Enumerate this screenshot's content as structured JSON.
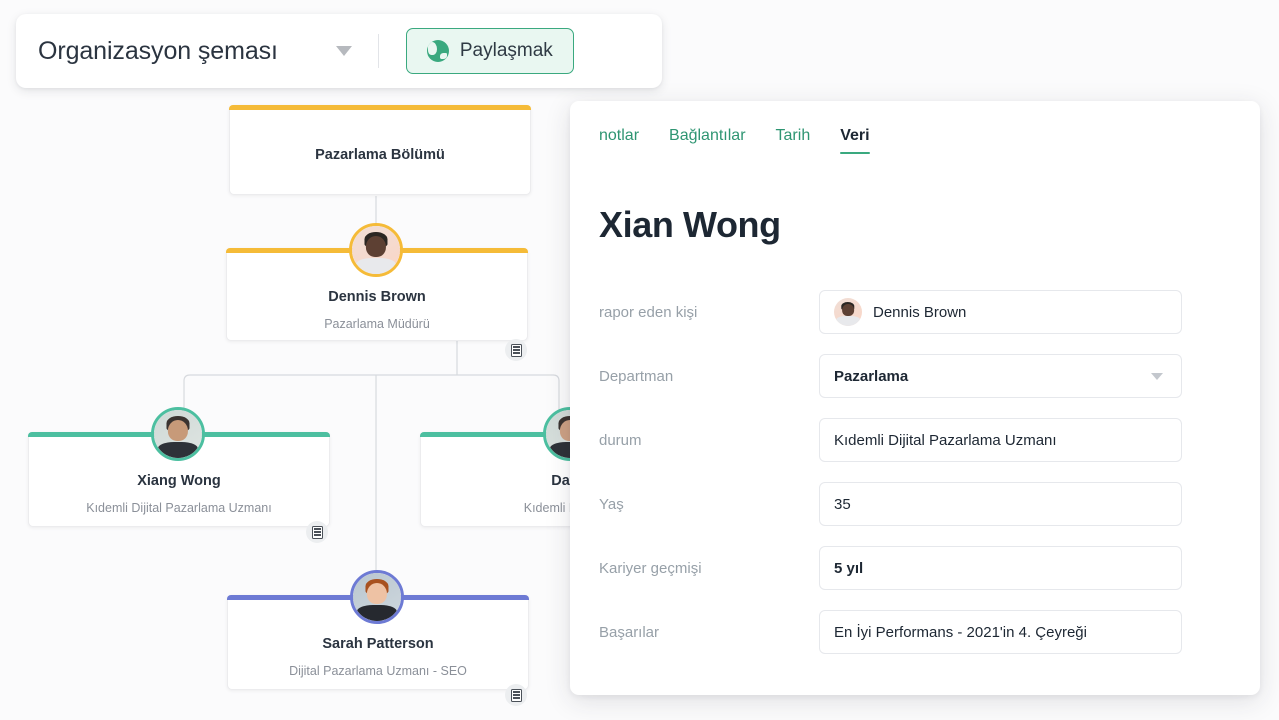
{
  "toolbar": {
    "chart_title": "Organizasyon şeması",
    "dropdown_icon": "chevron-down-icon",
    "share_label": "Paylaşmak",
    "share_icon": "globe-icon"
  },
  "colors": {
    "accent_green": "#3aa97f",
    "tab_link": "#2e9572",
    "node_yellow": "#f5bb38",
    "node_teal": "#4cbfa0",
    "node_purple": "#6d7ad4",
    "page_background": "#fbfbfc"
  },
  "org_chart": {
    "nodes": [
      {
        "id": "department",
        "title": "Pazarlama Bölümü",
        "subtitle": "",
        "accent": "#f5bb38",
        "has_avatar": false,
        "has_db_button": false
      },
      {
        "id": "dennis-brown",
        "title": "Dennis Brown",
        "subtitle": "Pazarlama Müdürü",
        "accent": "#f5bb38",
        "has_avatar": true,
        "has_db_button": true,
        "db_icon": "database-icon"
      },
      {
        "id": "xiang-wong",
        "title": "Xiang Wong",
        "subtitle": "Kıdemli Dijital Pazarlama Uzmanı",
        "accent": "#4cbfa0",
        "has_avatar": true,
        "has_db_button": true,
        "db_icon": "database-icon"
      },
      {
        "id": "david",
        "title": "David",
        "subtitle": "Kıdemli Dijital Pa",
        "accent": "#4cbfa0",
        "has_avatar": true,
        "has_db_button": false
      },
      {
        "id": "sarah-patterson",
        "title": "Sarah Patterson",
        "subtitle": "Dijital Pazarlama Uzmanı - SEO",
        "accent": "#6d7ad4",
        "has_avatar": true,
        "has_db_button": true,
        "db_icon": "database-icon"
      }
    ]
  },
  "panel": {
    "tabs": [
      {
        "label": "notlar",
        "active": false
      },
      {
        "label": "Bağlantılar",
        "active": false
      },
      {
        "label": "Tarih",
        "active": false
      },
      {
        "label": "Veri",
        "active": true
      }
    ],
    "person_name": "Xian Wong",
    "fields": [
      {
        "label": "rapor eden kişi",
        "value": "Dennis Brown",
        "type": "person",
        "avatar": "dennis-brown-avatar"
      },
      {
        "label": "Departman",
        "value": "Pazarlama",
        "type": "select",
        "caret": "chevron-down-icon"
      },
      {
        "label": "durum",
        "value": "Kıdemli Dijital Pazarlama Uzmanı",
        "type": "text"
      },
      {
        "label": "Yaş",
        "value": "35",
        "type": "text"
      },
      {
        "label": "Kariyer geçmişi",
        "value": "5 yıl",
        "type": "text"
      },
      {
        "label": "Başarılar",
        "value": "En İyi Performans - 2021'in 4. Çeyreği",
        "type": "text"
      }
    ]
  }
}
